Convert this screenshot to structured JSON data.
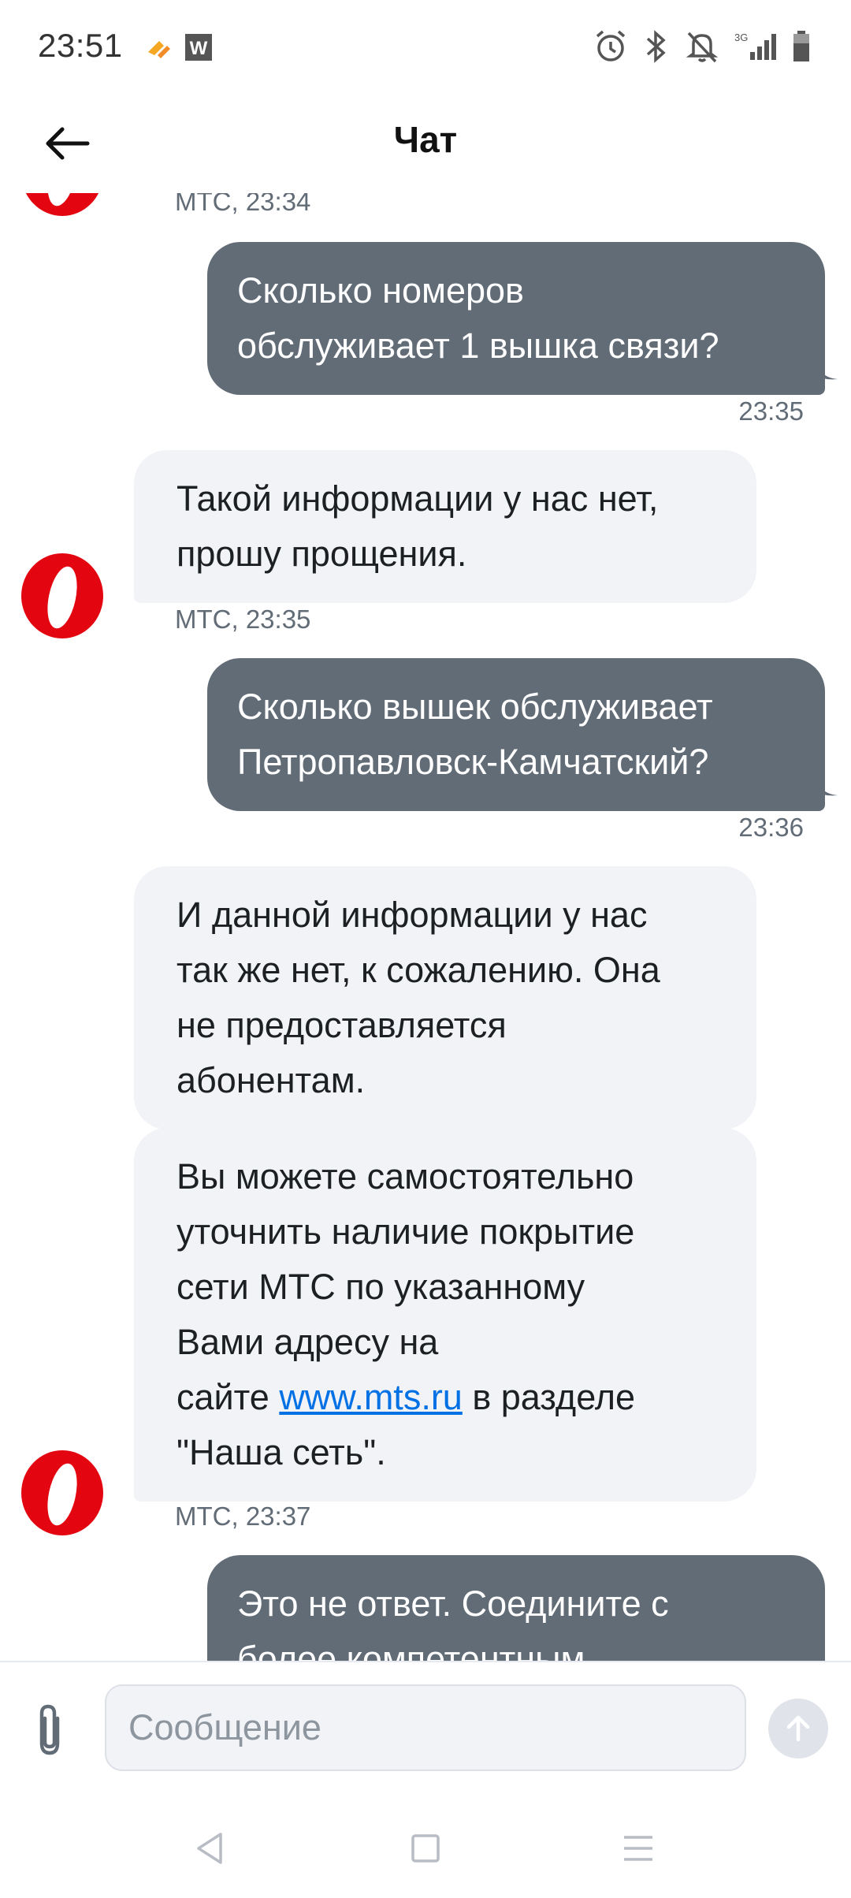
{
  "status_bar": {
    "time": "23:51",
    "network_label": "3G",
    "icons": [
      "notification-app-icon",
      "notification-w-icon",
      "alarm-icon",
      "bluetooth-icon",
      "mute-notifications-icon",
      "signal-icon",
      "battery-icon"
    ]
  },
  "header": {
    "back_icon": "arrow-left-icon",
    "title": "Чат"
  },
  "messages": [
    {
      "id": "m0",
      "direction": "incoming",
      "sender": "МТС",
      "time": "23:34",
      "meta": "МТС, 23:34",
      "text": ""
    },
    {
      "id": "m1",
      "direction": "outgoing",
      "text": "Сколько номеров\nобслуживает 1 вышка связи?",
      "time": "23:35"
    },
    {
      "id": "m2",
      "direction": "incoming",
      "text": "Такой информации у нас нет,\nпрошу прощения.",
      "meta": "МТС, 23:35"
    },
    {
      "id": "m3",
      "direction": "outgoing",
      "text": "Сколько вышек обслуживает\nПетропавловск-Камчатский?",
      "time": "23:36"
    },
    {
      "id": "m4",
      "direction": "incoming",
      "text": "И данной информации у нас\nтак же нет, к сожалению. Она\nне предоставляется\nабонентам."
    },
    {
      "id": "m5",
      "direction": "incoming",
      "text_before": "Вы можете самостоятельно\nуточнить наличие покрытие\nсети МТС по указанному\nВами адресу на\nсайте ",
      "link_text": "www.mts.ru",
      "text_after": " в разделе\n\"Наша сеть\".",
      "meta": "МТС, 23:37"
    },
    {
      "id": "m6",
      "direction": "outgoing",
      "text": "Это не ответ. Соедините с\nболее компетентным"
    }
  ],
  "input": {
    "placeholder": "Сообщение",
    "value": ""
  },
  "colors": {
    "outgoing_bubble": "#626c77",
    "incoming_bubble": "#f2f3f7",
    "brand_red": "#e30611",
    "link": "#0070e5",
    "timestamp": "#626c77"
  }
}
